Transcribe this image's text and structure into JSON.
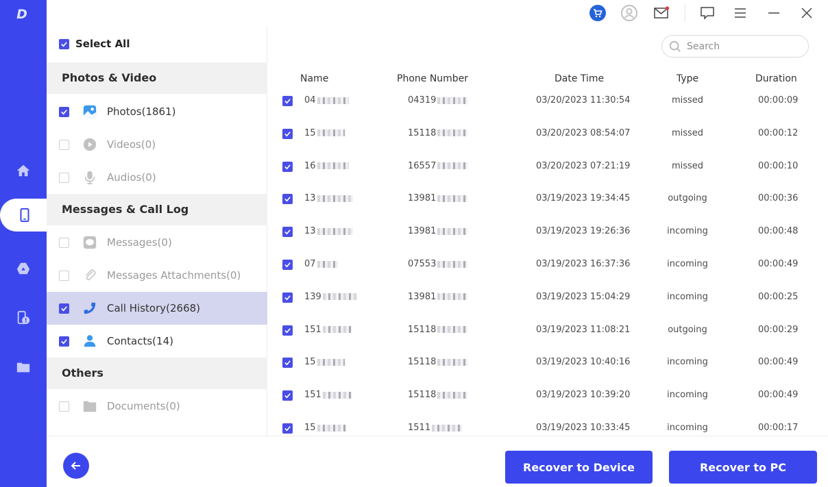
{
  "app": {
    "logo_text": "D",
    "accent_color": "#3b47ec",
    "checkbox_color": "#4a4ee6"
  },
  "rail": {
    "items": [
      {
        "name": "home",
        "icon": "home-icon",
        "active": false
      },
      {
        "name": "device",
        "icon": "phone-icon",
        "active": true
      },
      {
        "name": "google-drive",
        "icon": "google-drive-icon",
        "active": false
      },
      {
        "name": "device-alert",
        "icon": "device-alert-icon",
        "active": false
      },
      {
        "name": "files",
        "icon": "folder-icon",
        "active": false
      }
    ]
  },
  "topbar": {
    "icons": [
      "cart-icon",
      "user-avatar-icon",
      "mail-icon",
      "feedback-icon",
      "menu-icon",
      "minimize-icon",
      "close-icon"
    ]
  },
  "categories": {
    "select_all_label": "Select All",
    "select_all_checked": true,
    "groups": [
      {
        "title": "Photos & Video",
        "items": [
          {
            "label": "Photos(1861)",
            "icon": "photo-icon",
            "checked": true,
            "disabled": false,
            "selected": false
          },
          {
            "label": "Videos(0)",
            "icon": "play-icon",
            "checked": false,
            "disabled": true,
            "selected": false
          },
          {
            "label": "Audios(0)",
            "icon": "microphone-icon",
            "checked": false,
            "disabled": true,
            "selected": false
          }
        ]
      },
      {
        "title": "Messages & Call Log",
        "items": [
          {
            "label": "Messages(0)",
            "icon": "message-icon",
            "checked": false,
            "disabled": true,
            "selected": false
          },
          {
            "label": "Messages Attachments(0)",
            "icon": "paperclip-icon",
            "checked": false,
            "disabled": true,
            "selected": false
          },
          {
            "label": "Call History(2668)",
            "icon": "phone-call-icon",
            "checked": true,
            "disabled": false,
            "selected": true
          },
          {
            "label": "Contacts(14)",
            "icon": "contact-icon",
            "checked": true,
            "disabled": false,
            "selected": false
          }
        ]
      },
      {
        "title": "Others",
        "items": [
          {
            "label": "Documents(0)",
            "icon": "folder-icon",
            "checked": false,
            "disabled": true,
            "selected": false
          }
        ]
      }
    ]
  },
  "search": {
    "placeholder": "Search",
    "value": ""
  },
  "table": {
    "columns": [
      "Name",
      "Phone Number",
      "Date Time",
      "Type",
      "Duration"
    ],
    "rows": [
      {
        "checked": true,
        "name": "04",
        "phone": "04319",
        "datetime": "03/20/2023 11:30:54",
        "type": "missed",
        "duration": "00:00:09"
      },
      {
        "checked": true,
        "name": "15",
        "phone": "15118",
        "datetime": "03/20/2023 08:54:07",
        "type": "missed",
        "duration": "00:00:12"
      },
      {
        "checked": true,
        "name": "16",
        "phone": "16557",
        "datetime": "03/20/2023 07:21:19",
        "type": "missed",
        "duration": "00:00:10"
      },
      {
        "checked": true,
        "name": "13",
        "phone": "13981",
        "datetime": "03/19/2023 19:34:45",
        "type": "outgoing",
        "duration": "00:00:36"
      },
      {
        "checked": true,
        "name": "13",
        "phone": "13981",
        "datetime": "03/19/2023 19:26:36",
        "type": "incoming",
        "duration": "00:00:48"
      },
      {
        "checked": true,
        "name": "07",
        "phone": "07553",
        "datetime": "03/19/2023 16:37:36",
        "type": "incoming",
        "duration": "00:00:49"
      },
      {
        "checked": true,
        "name": "139",
        "phone": "13981",
        "datetime": "03/19/2023 15:04:29",
        "type": "incoming",
        "duration": "00:00:25"
      },
      {
        "checked": true,
        "name": "151",
        "phone": "15118",
        "datetime": "03/19/2023 11:08:21",
        "type": "outgoing",
        "duration": "00:00:29"
      },
      {
        "checked": true,
        "name": "15",
        "phone": "15118",
        "datetime": "03/19/2023 10:40:16",
        "type": "incoming",
        "duration": "00:00:49"
      },
      {
        "checked": true,
        "name": "151",
        "phone": "15118",
        "datetime": "03/19/2023 10:39:20",
        "type": "incoming",
        "duration": "00:00:49"
      },
      {
        "checked": true,
        "name": "15",
        "phone": "1511",
        "datetime": "03/19/2023 10:33:45",
        "type": "incoming",
        "duration": "00:00:17"
      }
    ]
  },
  "footer": {
    "back_icon": "arrow-left-icon",
    "recover_device_label": "Recover to Device",
    "recover_pc_label": "Recover to PC"
  }
}
